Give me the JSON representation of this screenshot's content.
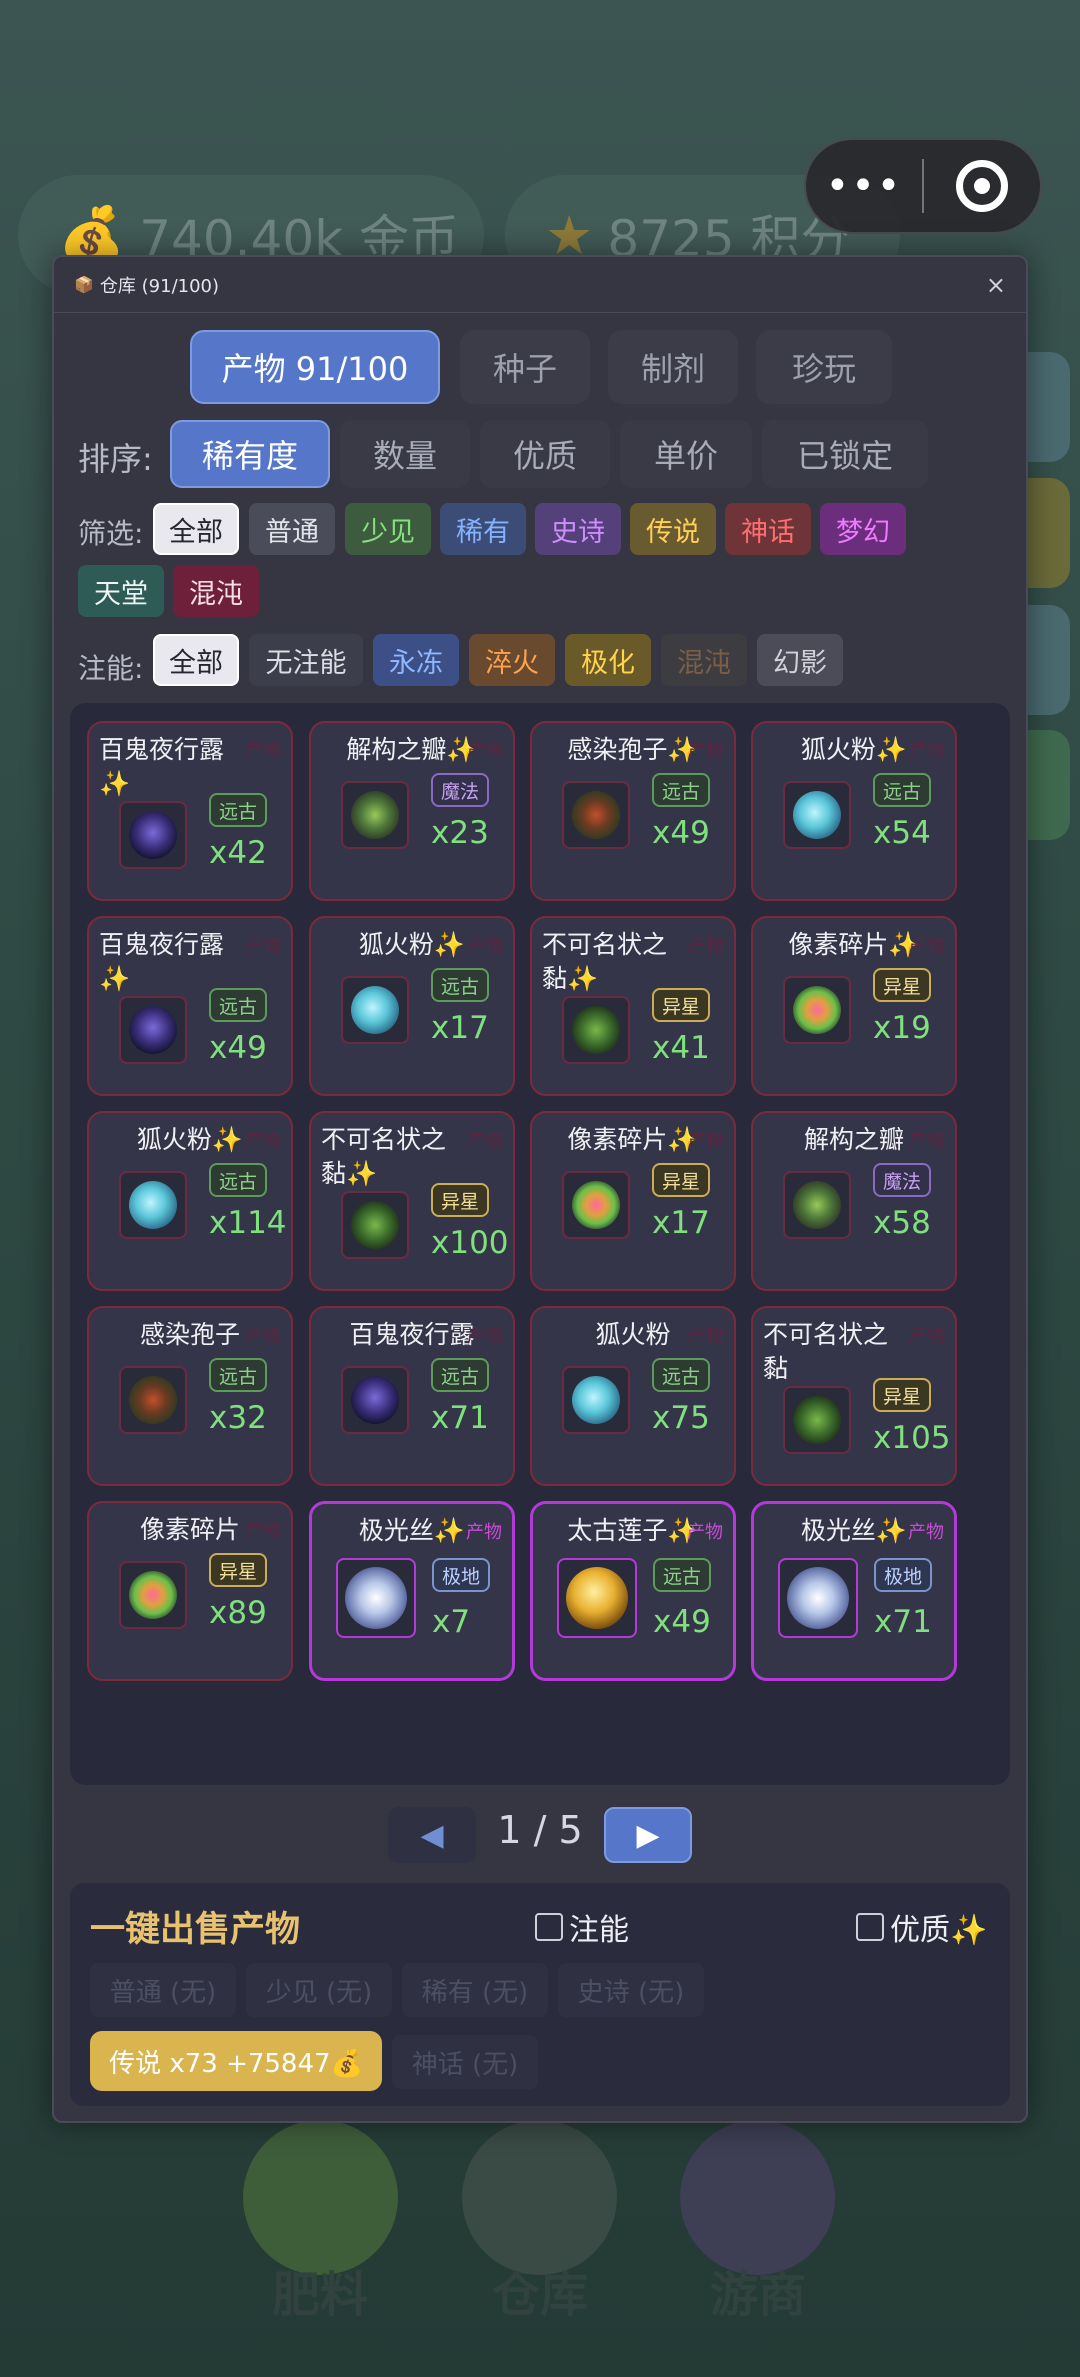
{
  "background": {
    "coins": "740.40k 金币",
    "points": "8725 积分",
    "dock": [
      "肥料",
      "仓库",
      "游商"
    ]
  },
  "dialog": {
    "title": "仓库 (91/100)",
    "close": "×"
  },
  "tabs": [
    {
      "label": "产物 91/100",
      "active": true
    },
    {
      "label": "种子",
      "active": false
    },
    {
      "label": "制剂",
      "active": false
    },
    {
      "label": "珍玩",
      "active": false
    }
  ],
  "sort": {
    "label": "排序:",
    "options": [
      {
        "label": "稀有度",
        "active": true
      },
      {
        "label": "数量",
        "active": false
      },
      {
        "label": "优质",
        "active": false
      },
      {
        "label": "单价",
        "active": false
      },
      {
        "label": "已锁定",
        "active": false
      }
    ]
  },
  "filter": {
    "label": "筛选:",
    "options": [
      {
        "label": "全部",
        "color": "#e8e8ee",
        "selected": true
      },
      {
        "label": "普通",
        "color": "#c8c9d2"
      },
      {
        "label": "少见",
        "color": "#74d173"
      },
      {
        "label": "稀有",
        "color": "#7aa9ff"
      },
      {
        "label": "史诗",
        "color": "#c27cff"
      },
      {
        "label": "传说",
        "color": "#f2c34e"
      },
      {
        "label": "神话",
        "color": "#ff6060"
      },
      {
        "label": "梦幻",
        "color": "#e06cff"
      },
      {
        "label": "天堂",
        "color": "#f4f4f8"
      },
      {
        "label": "混沌",
        "color": "#f4d8e0"
      }
    ]
  },
  "infuse": {
    "label": "注能:",
    "options": [
      {
        "label": "全部",
        "selected": true
      },
      {
        "label": "无注能"
      },
      {
        "label": "永冻"
      },
      {
        "label": "淬火"
      },
      {
        "label": "极化"
      },
      {
        "label": "混沌"
      },
      {
        "label": "幻影"
      }
    ]
  },
  "items": [
    {
      "name": "百鬼夜行露✨",
      "category": "产物",
      "tag": "远古",
      "tagType": "ancient",
      "qty": "x42",
      "icon": "ghost-dew-icon"
    },
    {
      "name": "解构之瓣✨",
      "category": "产物",
      "tag": "魔法",
      "tagType": "magic",
      "qty": "x23",
      "icon": "deconstruct-petal-icon"
    },
    {
      "name": "感染孢子✨",
      "category": "产物",
      "tag": "远古",
      "tagType": "ancient",
      "qty": "x49",
      "icon": "infected-spore-icon"
    },
    {
      "name": "狐火粉✨",
      "category": "产物",
      "tag": "远古",
      "tagType": "ancient",
      "qty": "x54",
      "icon": "foxfire-powder-icon"
    },
    {
      "name": "百鬼夜行露✨",
      "category": "产物",
      "tag": "远古",
      "tagType": "ancient",
      "qty": "x49",
      "icon": "ghost-dew-icon"
    },
    {
      "name": "狐火粉✨",
      "category": "产物",
      "tag": "远古",
      "tagType": "ancient",
      "qty": "x17",
      "icon": "foxfire-powder-icon"
    },
    {
      "name": "不可名状之黏✨",
      "category": "产物",
      "tag": "异星",
      "tagType": "alien",
      "qty": "x41",
      "icon": "nameless-slime-icon"
    },
    {
      "name": "像素碎片✨",
      "category": "产物",
      "tag": "异星",
      "tagType": "alien",
      "qty": "x19",
      "icon": "pixel-shard-icon"
    },
    {
      "name": "狐火粉✨",
      "category": "产物",
      "tag": "远古",
      "tagType": "ancient",
      "qty": "x114",
      "icon": "foxfire-powder-icon"
    },
    {
      "name": "不可名状之黏✨",
      "category": "产物",
      "tag": "异星",
      "tagType": "alien",
      "qty": "x100",
      "icon": "nameless-slime-icon"
    },
    {
      "name": "像素碎片✨",
      "category": "产物",
      "tag": "异星",
      "tagType": "alien",
      "qty": "x17",
      "icon": "pixel-shard-icon"
    },
    {
      "name": "解构之瓣",
      "category": "产物",
      "tag": "魔法",
      "tagType": "magic",
      "qty": "x58",
      "icon": "deconstruct-petal-icon"
    },
    {
      "name": "感染孢子",
      "category": "产物",
      "tag": "远古",
      "tagType": "ancient",
      "qty": "x32",
      "icon": "infected-spore-icon"
    },
    {
      "name": "百鬼夜行露",
      "category": "产物",
      "tag": "远古",
      "tagType": "ancient",
      "qty": "x71",
      "icon": "ghost-dew-icon"
    },
    {
      "name": "狐火粉",
      "category": "产物",
      "tag": "远古",
      "tagType": "ancient",
      "qty": "x75",
      "icon": "foxfire-powder-icon"
    },
    {
      "name": "不可名状之黏",
      "category": "产物",
      "tag": "异星",
      "tagType": "alien",
      "qty": "x105",
      "icon": "nameless-slime-icon"
    },
    {
      "name": "像素碎片",
      "category": "产物",
      "tag": "异星",
      "tagType": "alien",
      "qty": "x89",
      "icon": "pixel-shard-icon"
    },
    {
      "name": "极光丝✨",
      "category": "产物",
      "tag": "极地",
      "tagType": "polar",
      "qty": "x7",
      "icon": "aurora-silk-icon",
      "myth": true
    },
    {
      "name": "太古莲子✨",
      "category": "产物",
      "tag": "远古",
      "tagType": "ancient",
      "qty": "x49",
      "icon": "ancient-lotus-seed-icon",
      "myth": true
    },
    {
      "name": "极光丝✨",
      "category": "产物",
      "tag": "极地",
      "tagType": "polar",
      "qty": "x71",
      "icon": "aurora-silk-icon",
      "myth": true
    }
  ],
  "pager": {
    "text": "1 / 5",
    "prev": "◀",
    "next": "▶"
  },
  "sell": {
    "title": "一键出售产物",
    "infuse_label": "注能",
    "quality_label": "优质✨",
    "options": [
      {
        "label": "普通 (无)"
      },
      {
        "label": "少见 (无)"
      },
      {
        "label": "稀有 (无)"
      },
      {
        "label": "史诗 (无)"
      },
      {
        "label": "传说 x73 +75847💰",
        "active": true
      },
      {
        "label": "神话 (无)"
      }
    ]
  },
  "colors": {
    "accent": "#5677c9",
    "myth_border": "#b33ad8",
    "legend_border": "#7a2a3c",
    "qty": "#7fe07d",
    "sell_gold": "#d9b44f"
  }
}
